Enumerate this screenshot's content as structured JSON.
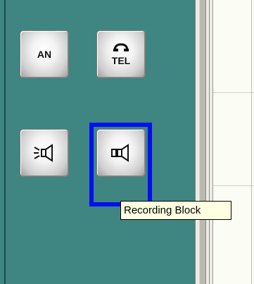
{
  "theme": {
    "panel_color": "#3f8582",
    "selection_color": "#0010f0"
  },
  "buttons": {
    "an": {
      "label": "AN",
      "icon": "an-label"
    },
    "tel": {
      "label": "TEL",
      "icon": "telephone-handset-icon"
    },
    "announcement": {
      "icon": "speaker-sound-icon"
    },
    "recording": {
      "icon": "speaker-icon"
    }
  },
  "tooltip": {
    "text": "Recording Block"
  }
}
